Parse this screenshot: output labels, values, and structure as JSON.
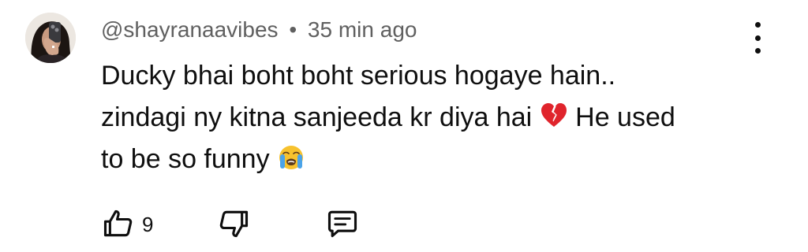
{
  "comment": {
    "author": "@shayranaavibes",
    "separator": "•",
    "time": "35 min ago",
    "text_line_1": "Ducky bhai boht boht serious hogaye hain..",
    "text_line_2": "zindagi ny kitna sanjeeda kr diya hai",
    "text_line_2_after": "He used",
    "text_line_3": "to be so funny",
    "emoji_1": "broken-heart-emoji",
    "emoji_2": "loudly-crying-face-emoji",
    "like_count": "9"
  },
  "colors": {
    "meta_text": "#606060",
    "body_text": "#0f0f0f",
    "heart_red": "#e0242c",
    "emoji_yellow": "#f7c22e",
    "tear_blue": "#4ba3e8"
  },
  "icons": {
    "like": "thumbs-up-icon",
    "dislike": "thumbs-down-icon",
    "reply": "comment-icon",
    "more": "more-vertical-icon"
  }
}
